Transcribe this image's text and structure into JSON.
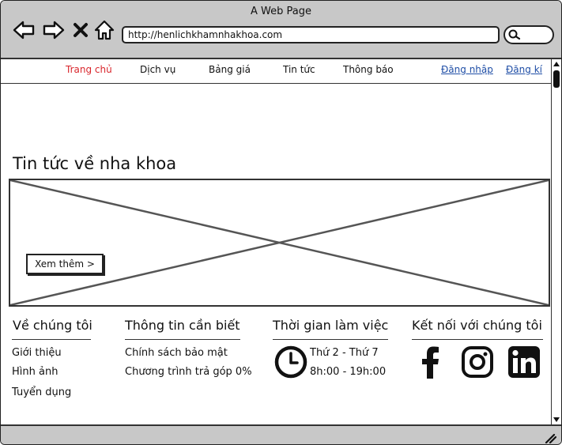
{
  "window": {
    "title": "A Web Page"
  },
  "address_bar": {
    "url": "http://henlichkhamnhakhoa.com"
  },
  "nav": {
    "items": [
      {
        "label": "Trang chủ",
        "active": true
      },
      {
        "label": "Dịch vụ",
        "active": false
      },
      {
        "label": "Bảng giá",
        "active": false
      },
      {
        "label": "Tin tức",
        "active": false
      },
      {
        "label": "Thông báo",
        "active": false
      }
    ],
    "login": "Đăng nhập",
    "register": "Đăng kí"
  },
  "main": {
    "title": "Tin tức về nha khoa",
    "more_button": "Xem thêm >"
  },
  "footer": {
    "about": {
      "heading": "Về chúng tôi",
      "items": [
        "Giới thiệu",
        "Hình ảnh",
        "Tuyển dụng"
      ]
    },
    "info": {
      "heading": "Thông tin cần biết",
      "items": [
        "Chính sách bảo mật",
        "Chương trình trả góp 0%"
      ]
    },
    "hours": {
      "heading": "Thời gian làm việc",
      "days": "Thứ 2 - Thứ 7",
      "time": "8h:00 - 19h:00"
    },
    "social": {
      "heading": "Kết nối với chúng tôi",
      "icons": [
        "facebook-icon",
        "instagram-icon",
        "linkedin-icon"
      ]
    }
  },
  "colors": {
    "active_nav": "#d9262c",
    "link": "#1f4ea6",
    "chrome": "#c8c8c8"
  }
}
